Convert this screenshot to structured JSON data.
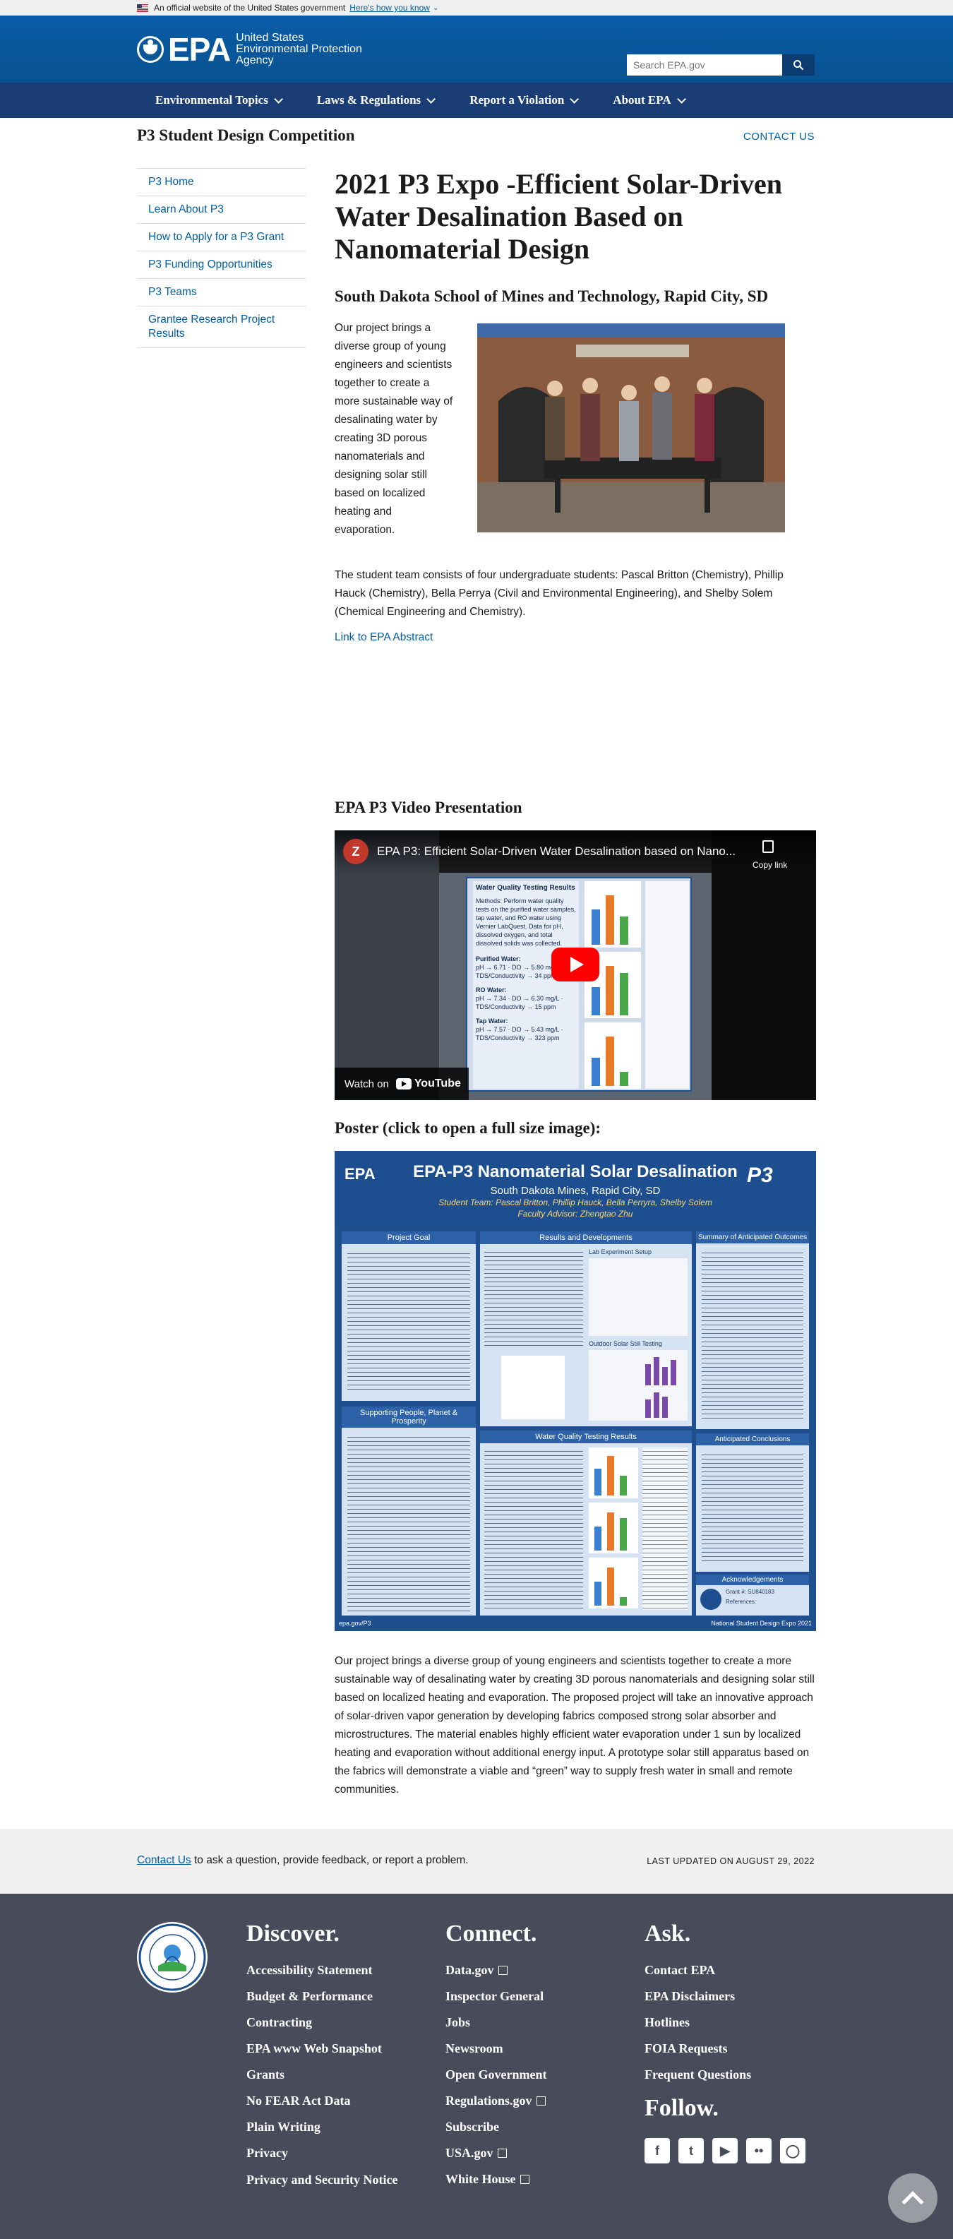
{
  "gov_banner": {
    "text": "An official website of the United States government",
    "link": "Here's how you know"
  },
  "header": {
    "logo_word": "EPA",
    "agency_line1": "United States",
    "agency_line2": "Environmental Protection",
    "agency_line3": "Agency",
    "search_placeholder": "Search EPA.gov"
  },
  "nav": {
    "items": [
      {
        "label": "Environmental Topics"
      },
      {
        "label": "Laws & Regulations"
      },
      {
        "label": "Report a Violation"
      },
      {
        "label": "About EPA"
      }
    ]
  },
  "titlebar": {
    "site_title": "P3 Student Design Competition",
    "contact": "CONTACT US"
  },
  "sidebar": {
    "items": [
      {
        "label": "P3 Home"
      },
      {
        "label": "Learn About P3"
      },
      {
        "label": "How to Apply for a P3 Grant"
      },
      {
        "label": "P3 Funding Opportunities"
      },
      {
        "label": "P3 Teams"
      },
      {
        "label": "Grantee Research Project Results"
      }
    ]
  },
  "main": {
    "title": "2021 P3 Expo -Efficient Solar-Driven Water Desalination Based on Nanomaterial Design",
    "school": "South Dakota School of Mines and Technology, Rapid City, SD",
    "intro": "Our project brings a diverse group of young engineers and scientists together to create a more sustainable way of desalinating water by creating 3D porous nanomaterials and designing solar still based on localized heating and evaporation.",
    "students": "The student team consists of four undergraduate students: Pascal Britton (Chemistry), Phillip Hauck (Chemistry), Bella Perrya (Civil and Environmental Engineering), and Shelby Solem (Chemical Engineering and Chemistry).",
    "abstract_link": "Link to EPA Abstract",
    "video_heading": "EPA P3 Video Presentation",
    "video": {
      "channel_initial": "Z",
      "title": "EPA P3: Efficient Solar-Driven Water Desalination based on Nano...",
      "copy_link": "Copy link",
      "watch_on": "Watch on",
      "youtube": "YouTube",
      "slide_heading": "Water Quality Testing Results",
      "slide_methods": "Methods: Perform water quality tests on the purified water samples, tap water, and RO water using Vernier LabQuest. Data for pH, dissolved oxygen, and total dissolved solids was collected.",
      "slide_purified": "Purified Water:",
      "slide_purified_vals": "pH → 6.71 · DO → 5.80 mg/L · TDS/Conductivity → 34 ppm",
      "slide_ro": "RO Water:",
      "slide_ro_vals": "pH → 7.34 · DO → 6.30 mg/L · TDS/Conductivity → 15 ppm",
      "slide_tap": "Tap Water:",
      "slide_tap_vals": "pH → 7.57 · DO → 5.43 mg/L · TDS/Conductivity → 323 ppm"
    },
    "poster_heading": "Poster (click to open a full size image):",
    "poster": {
      "epa": "EPA",
      "title": "EPA-P3 Nanomaterial Solar Desalination",
      "school": "South Dakota Mines, Rapid City, SD",
      "students": "Student Team: Pascal Britton, Phillip Hauck, Bella Perryra, Shelby Solem",
      "advisor": "Faculty Advisor: Zhengtao Zhu",
      "p3": "P3",
      "project_goal": "Project Goal",
      "results": "Results and Developments",
      "summary": "Summary of Anticipated Outcomes",
      "supporting": "Supporting People, Planet & Prosperity",
      "water_quality": "Water Quality Testing Results",
      "conclusions": "Anticipated Conclusions",
      "acknowledgements": "Acknowledgements",
      "lab_setup": "Lab Experiment Setup",
      "outdoor": "Outdoor Solar Still Testing",
      "grant": "Grant #: SU840183",
      "references": "References:",
      "footer_left": "epa.gov/P3",
      "footer_right": "National Student Design Expo 2021"
    },
    "description": "Our project brings a diverse group of young engineers and scientists together to create a more sustainable way of desalinating water by creating 3D porous nanomaterials and designing solar still based on localized heating and evaporation. The proposed project will take an innovative approach of solar-driven vapor generation by developing fabrics composed strong solar absorber and microstructures. The material enables highly efficient water evaporation under 1 sun by localized heating and evaporation without additional energy input. A prototype solar still apparatus based on the fabrics will demonstrate a viable and “green” way to supply fresh water in small and remote communities."
  },
  "feedback": {
    "contact_link": "Contact Us",
    "text": " to ask a question, provide feedback, or report a problem.",
    "updated": "LAST UPDATED ON AUGUST 29, 2022"
  },
  "footer": {
    "discover": {
      "title": "Discover.",
      "links": [
        "Accessibility Statement",
        "Budget & Performance",
        "Contracting",
        "EPA www Web Snapshot",
        "Grants",
        "No FEAR Act Data",
        "Plain Writing",
        "Privacy",
        "Privacy and Security Notice"
      ]
    },
    "connect": {
      "title": "Connect.",
      "links": [
        "Data.gov",
        "Inspector General",
        "Jobs",
        "Newsroom",
        "Open Government",
        "Regulations.gov",
        "Subscribe",
        "USA.gov",
        "White House"
      ]
    },
    "ask": {
      "title": "Ask.",
      "links": [
        "Contact EPA",
        "EPA Disclaimers",
        "Hotlines",
        "FOIA Requests",
        "Frequent Questions"
      ]
    },
    "follow": {
      "title": "Follow."
    }
  },
  "colors": {
    "primary_blue": "#0b5aa8",
    "nav_blue": "#1a3d75",
    "link": "#005ea2",
    "footer_bg": "#474b5a"
  }
}
